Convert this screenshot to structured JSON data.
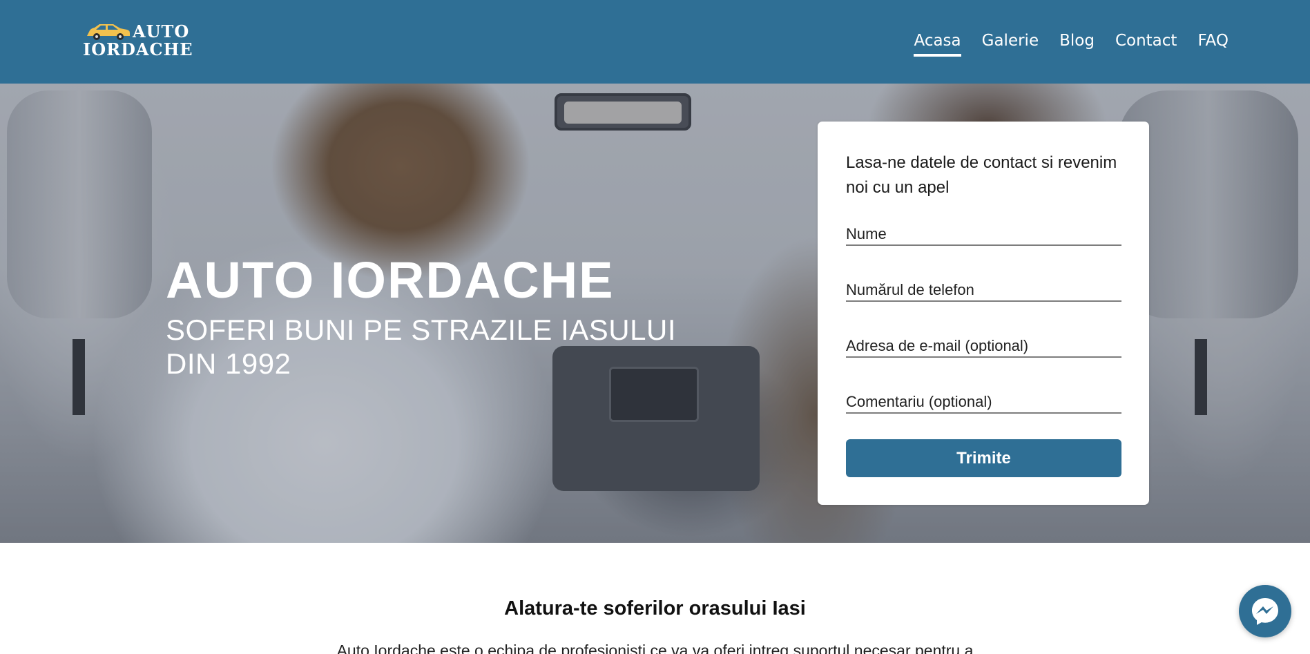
{
  "brand": {
    "line1": "AUTO",
    "line2": "IORDACHE",
    "logo_icon": "taxi-car-icon",
    "primary_color": "#2f6f95",
    "logo_car_color": "#f2c14e"
  },
  "nav": {
    "items": [
      {
        "label": "Acasa",
        "active": true
      },
      {
        "label": "Galerie",
        "active": false
      },
      {
        "label": "Blog",
        "active": false
      },
      {
        "label": "Contact",
        "active": false
      },
      {
        "label": "FAQ",
        "active": false
      }
    ]
  },
  "hero": {
    "title": "AUTO IORDACHE",
    "subtitle": "SOFERI BUNI PE STRAZILE IASULUI DIN 1992"
  },
  "form": {
    "title": "Lasa-ne datele de contact si revenim noi cu un apel",
    "fields": {
      "name": {
        "placeholder": "Nume",
        "value": ""
      },
      "phone": {
        "placeholder": "Numărul de telefon",
        "value": ""
      },
      "email": {
        "placeholder": "Adresa de e-mail (optional)",
        "value": ""
      },
      "comment": {
        "placeholder": "Comentariu (optional)",
        "value": ""
      }
    },
    "submit_label": "Trimite"
  },
  "section": {
    "title": "Alatura-te soferilor orasului Iasi",
    "text": "Auto Iordache este o echipa de profesionisti ce va va oferi intreg suportul necesar pentru a"
  },
  "chat": {
    "icon": "messenger-icon"
  }
}
